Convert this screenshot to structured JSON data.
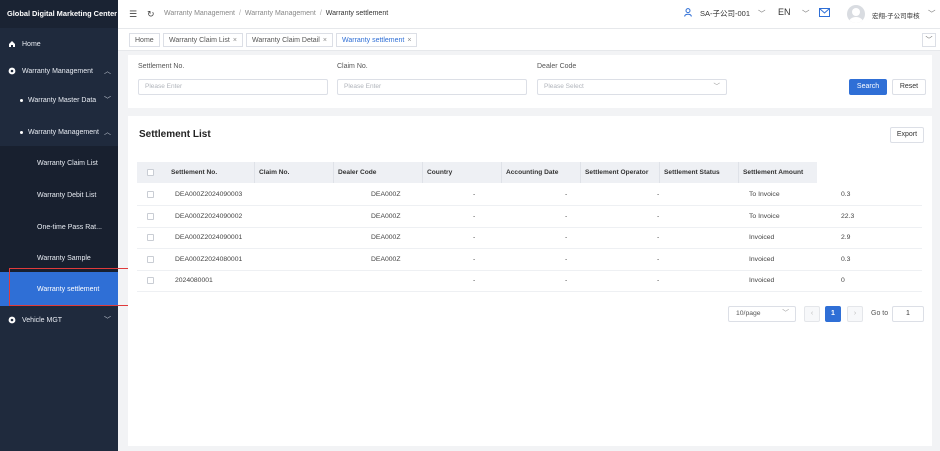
{
  "app": {
    "title": "Global Digital Marketing Center"
  },
  "sidebar": {
    "items": [
      {
        "label": "Home"
      },
      {
        "label": "Warranty Management"
      },
      {
        "label": "Warranty Master Data"
      },
      {
        "label": "Warranty Management"
      },
      {
        "label": "Warranty Claim List"
      },
      {
        "label": "Warranty Debit List"
      },
      {
        "label": "One-time Pass Rat..."
      },
      {
        "label": "Warranty Sample"
      },
      {
        "label": "Warranty settlement"
      },
      {
        "label": "Vehicle MGT"
      }
    ]
  },
  "header": {
    "breadcrumb": [
      "Warranty Management",
      "Warranty Management",
      "Warranty settlement"
    ],
    "role": "SA-子公司-001",
    "language": "EN",
    "username": "宏翔-子公司审核"
  },
  "tabs": [
    {
      "label": "Home"
    },
    {
      "label": "Warranty Claim List"
    },
    {
      "label": "Warranty Claim Detail"
    },
    {
      "label": "Warranty settlement"
    }
  ],
  "filters": {
    "settlement_no": {
      "label": "Settlement No.",
      "placeholder": "Please Enter"
    },
    "claim_no": {
      "label": "Claim No.",
      "placeholder": "Please Enter"
    },
    "dealer_code": {
      "label": "Dealer Code",
      "placeholder": "Please Select"
    },
    "search_label": "Search",
    "reset_label": "Reset"
  },
  "list": {
    "title": "Settlement List",
    "export_label": "Export",
    "columns": [
      "Settlement No.",
      "Claim No.",
      "Dealer Code",
      "Country",
      "Accounting Date",
      "Settlement Operator",
      "Settlement Status",
      "Settlement Amount"
    ],
    "rows": [
      {
        "settlement_no": "DEA000Z2024090003",
        "claim_no": "",
        "dealer_code": "DEA000Z",
        "country": "-",
        "accounting_date": "-",
        "operator": "-",
        "status": "To Invoice",
        "amount": "0.3"
      },
      {
        "settlement_no": "DEA000Z2024090002",
        "claim_no": "",
        "dealer_code": "DEA000Z",
        "country": "-",
        "accounting_date": "-",
        "operator": "-",
        "status": "To Invoice",
        "amount": "22.3"
      },
      {
        "settlement_no": "DEA000Z2024090001",
        "claim_no": "",
        "dealer_code": "DEA000Z",
        "country": "-",
        "accounting_date": "-",
        "operator": "-",
        "status": "Invoiced",
        "amount": "2.9"
      },
      {
        "settlement_no": "DEA000Z2024080001",
        "claim_no": "",
        "dealer_code": "DEA000Z",
        "country": "-",
        "accounting_date": "-",
        "operator": "-",
        "status": "Invoiced",
        "amount": "0.3"
      },
      {
        "settlement_no": "2024080001",
        "claim_no": "",
        "dealer_code": "",
        "country": "-",
        "accounting_date": "-",
        "operator": "-",
        "status": "Invoiced",
        "amount": "0"
      }
    ]
  },
  "pagination": {
    "page_size": "10/page",
    "current_page": "1",
    "goto_label": "Go to",
    "goto_value": "1"
  },
  "colors": {
    "sidebar_bg": "#1f2a3d",
    "accent": "#2f6fd6",
    "highlight": "#e03b3b"
  }
}
